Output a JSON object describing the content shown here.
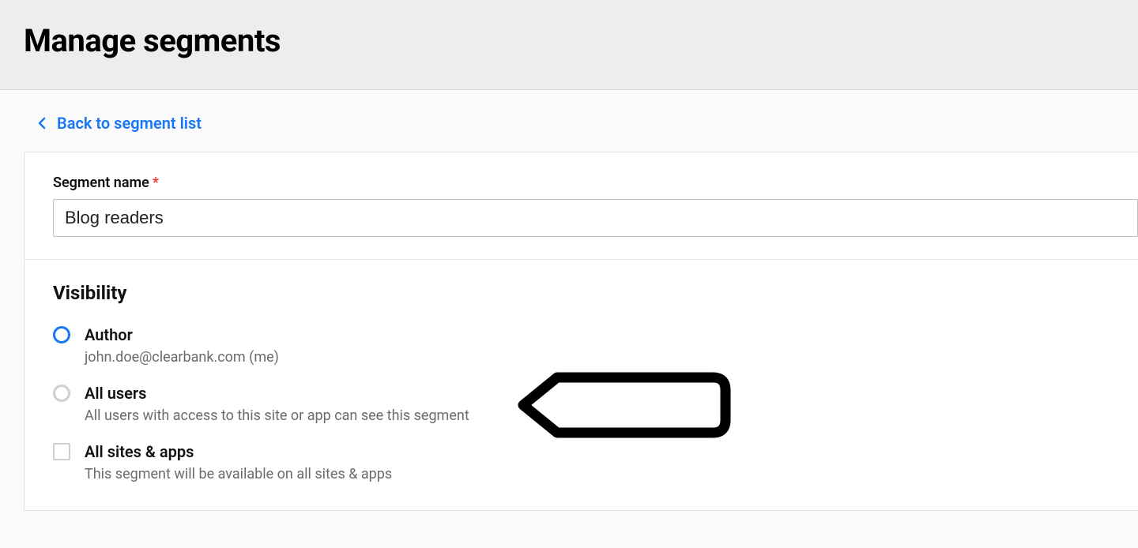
{
  "header": {
    "title": "Manage segments"
  },
  "back_link": {
    "label": "Back to segment list"
  },
  "segment_name": {
    "label": "Segment name",
    "required_mark": "*",
    "value": "Blog readers"
  },
  "visibility": {
    "heading": "Visibility",
    "options": [
      {
        "id": "author",
        "label": "Author",
        "sub": "john.doe@clearbank.com (me)",
        "control": "radio",
        "selected": true
      },
      {
        "id": "all-users",
        "label": "All users",
        "sub": "All users with access to this site or app can see this segment",
        "control": "radio",
        "selected": false
      },
      {
        "id": "all-sites",
        "label": "All sites & apps",
        "sub": "This segment will be available on all sites & apps",
        "control": "checkbox",
        "selected": false
      }
    ]
  }
}
